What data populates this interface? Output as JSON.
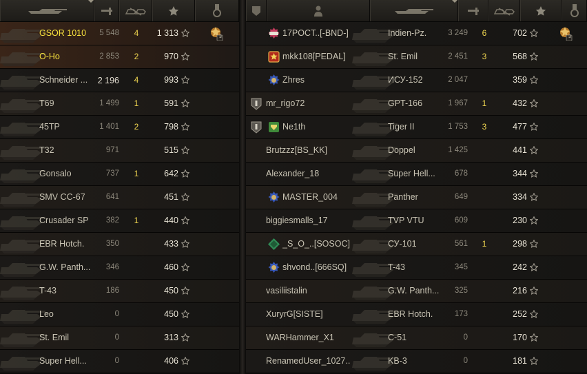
{
  "left_team": {
    "columns": [
      "tank-icon",
      "frags-icon",
      "kills-icon",
      "xp-star-icon",
      "medal-header-icon"
    ],
    "rows": [
      {
        "tank": "GSOR 1010",
        "damage": "5 548",
        "frags": "4",
        "xp": "1 313",
        "highlight": true,
        "medal": "3"
      },
      {
        "tank": "O-Ho",
        "damage": "2 853",
        "frags": "2",
        "xp": "970",
        "highlight": true
      },
      {
        "tank": "Schneider ...",
        "damage": "2 196",
        "frags": "4",
        "xp": "993",
        "damage_bright": true
      },
      {
        "tank": "T69",
        "damage": "1 499",
        "frags": "1",
        "xp": "591"
      },
      {
        "tank": "45TP",
        "damage": "1 401",
        "frags": "2",
        "xp": "798"
      },
      {
        "tank": "T32",
        "damage": "971",
        "frags": "",
        "xp": "515"
      },
      {
        "tank": "Gonsalo",
        "damage": "737",
        "frags": "1",
        "xp": "642"
      },
      {
        "tank": "SMV CC-67",
        "damage": "641",
        "frags": "",
        "xp": "451"
      },
      {
        "tank": "Crusader SP",
        "damage": "382",
        "frags": "1",
        "xp": "440"
      },
      {
        "tank": "EBR Hotch.",
        "damage": "350",
        "frags": "",
        "xp": "433"
      },
      {
        "tank": "G.W. Panth...",
        "damage": "346",
        "frags": "",
        "xp": "460"
      },
      {
        "tank": "T-43",
        "damage": "186",
        "frags": "",
        "xp": "450"
      },
      {
        "tank": "Leo",
        "damage": "0",
        "frags": "",
        "xp": "450"
      },
      {
        "tank": "St. Emil",
        "damage": "0",
        "frags": "",
        "xp": "313"
      },
      {
        "tank": "Super Hell...",
        "damage": "0",
        "frags": "",
        "xp": "406"
      }
    ]
  },
  "right_team": {
    "rows": [
      {
        "player": "17POCT..[-BND-]",
        "tank": "Indien-Pz.",
        "damage": "3 249",
        "frags": "6",
        "xp": "702",
        "clan": "nerf",
        "medal": "3"
      },
      {
        "player": "mkk108[PEDAL]",
        "tank": "St. Emil",
        "damage": "2 451",
        "frags": "3",
        "xp": "568",
        "clan": "star"
      },
      {
        "player": "Zhres",
        "tank": "ИСУ-152",
        "damage": "2 047",
        "frags": "",
        "xp": "359",
        "clan": "blue"
      },
      {
        "player": "mr_rigo72",
        "tank": "GPT-166",
        "damage": "1 967",
        "frags": "1",
        "xp": "432",
        "squad": true
      },
      {
        "player": "Ne1th",
        "tank": "Tiger II",
        "damage": "1 753",
        "frags": "3",
        "xp": "477",
        "squad": true,
        "clan": "green"
      },
      {
        "player": "Brutzzz[BS_KK]",
        "tank": "Doppel",
        "damage": "1 425",
        "frags": "",
        "xp": "441"
      },
      {
        "player": "Alexander_18",
        "tank": "Super Hell...",
        "damage": "678",
        "frags": "",
        "xp": "344"
      },
      {
        "player": "MASTER_004",
        "tank": "Panther",
        "damage": "649",
        "frags": "",
        "xp": "334",
        "clan": "blue"
      },
      {
        "player": "biggiesmalls_17",
        "tank": "TVP VTU",
        "damage": "609",
        "frags": "",
        "xp": "230"
      },
      {
        "player": "_S_O_..[SOSOC]",
        "tank": "СУ-101",
        "damage": "561",
        "frags": "1",
        "xp": "298",
        "clan": "diamond"
      },
      {
        "player": "shvond..[666SQ]",
        "tank": "T-43",
        "damage": "345",
        "frags": "",
        "xp": "242",
        "clan": "blue"
      },
      {
        "player": "vasiliistalin",
        "tank": "G.W. Panth...",
        "damage": "325",
        "frags": "",
        "xp": "216"
      },
      {
        "player": "XuryrG[SISTE]",
        "tank": "EBR Hotch.",
        "damage": "173",
        "frags": "",
        "xp": "252"
      },
      {
        "player": "WARHammer_X1",
        "tank": "C-51",
        "damage": "0",
        "frags": "",
        "xp": "170"
      },
      {
        "player": "RenamedUser_1027..",
        "tank": "KB-3",
        "damage": "0",
        "frags": "",
        "xp": "181"
      }
    ]
  },
  "colors": {
    "highlight": "#f7e03d",
    "frags": "#f0d650",
    "text": "#c9c4b4",
    "muted": "#8c877b"
  }
}
